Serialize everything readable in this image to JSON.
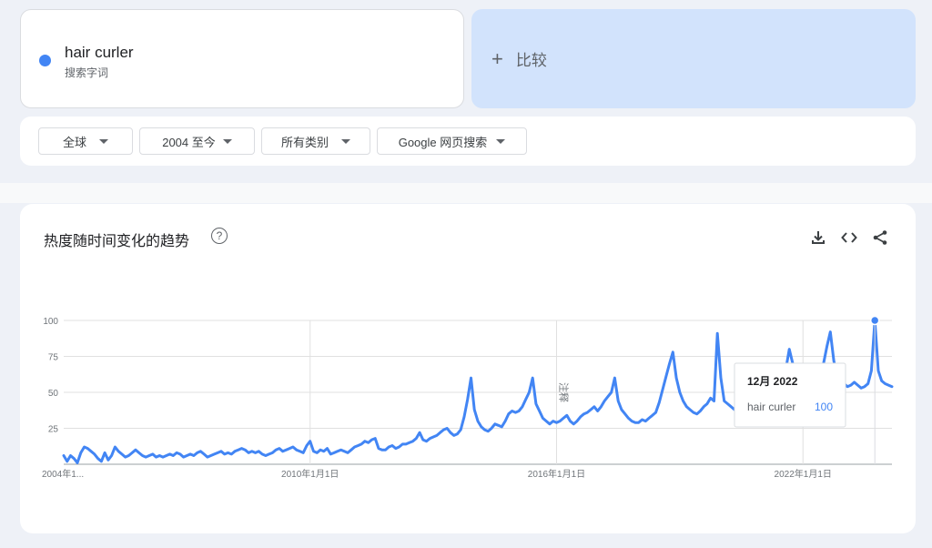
{
  "search_term": {
    "label": "hair curler",
    "type_label": "搜索字词",
    "color": "#4285f4"
  },
  "compare": {
    "plus": "+",
    "label": "比较"
  },
  "filters": [
    {
      "label": "全球"
    },
    {
      "label": "2004 至今"
    },
    {
      "label": "所有类别"
    },
    {
      "label": "Google 网页搜索"
    }
  ],
  "chart_panel": {
    "title": "热度随时间变化的趋势",
    "help": "?",
    "icons": [
      "download-icon",
      "embed-code-icon",
      "share-icon"
    ]
  },
  "chart_data": {
    "type": "line",
    "ylim": [
      0,
      100
    ],
    "y_ticks": [
      "100",
      "75",
      "50",
      "25"
    ],
    "x_tick_labels": [
      "2004年1...",
      "2010年1月1日",
      "2016年1月1日",
      "2022年1月1日"
    ],
    "note_label": "注释",
    "grid": true,
    "series": [
      {
        "name": "hair curler",
        "color": "#4285f4",
        "yearly_values": [
          [
            6,
            2,
            6,
            4,
            1,
            8,
            12,
            11,
            9,
            7,
            4,
            2
          ],
          [
            8,
            3,
            6,
            12,
            9,
            7,
            5,
            6,
            8,
            10,
            8,
            6
          ],
          [
            5,
            6,
            7,
            5,
            6,
            5,
            6,
            7,
            6,
            8,
            7,
            5
          ],
          [
            6,
            7,
            6,
            8,
            9,
            7,
            5,
            6,
            7,
            8,
            9,
            7
          ],
          [
            8,
            7,
            9,
            10,
            11,
            10,
            8,
            9,
            8,
            9,
            7,
            6
          ],
          [
            7,
            8,
            10,
            11,
            9,
            10,
            11,
            12,
            10,
            9,
            8,
            13
          ],
          [
            16,
            9,
            8,
            10,
            9,
            11,
            7,
            8,
            9,
            10,
            9,
            8
          ],
          [
            10,
            12,
            13,
            14,
            16,
            15,
            17,
            18,
            11,
            10,
            10,
            12
          ],
          [
            13,
            11,
            12,
            14,
            14,
            15,
            16,
            18,
            22,
            17,
            16,
            18
          ],
          [
            19,
            20,
            22,
            24,
            25,
            22,
            20,
            21,
            24,
            33,
            45,
            60
          ],
          [
            38,
            30,
            26,
            24,
            23,
            25,
            28,
            27,
            26,
            30,
            35,
            37
          ],
          [
            36,
            37,
            40,
            45,
            50,
            60,
            42,
            37,
            32,
            30,
            28,
            30
          ],
          [
            29,
            30,
            32,
            34,
            30,
            28,
            30,
            33,
            35,
            36,
            38,
            40
          ],
          [
            37,
            40,
            44,
            47,
            50,
            60,
            44,
            38,
            35,
            32,
            30,
            29
          ],
          [
            29,
            31,
            30,
            32,
            34,
            36,
            43,
            52,
            61,
            70,
            78,
            60
          ],
          [
            50,
            44,
            40,
            38,
            36,
            35,
            37,
            40,
            42,
            46,
            44,
            91
          ],
          [
            60,
            44,
            42,
            40,
            38,
            36,
            37,
            38,
            39,
            41,
            40,
            40
          ],
          [
            44,
            46,
            48,
            50,
            52,
            50,
            48,
            66,
            80,
            70,
            60,
            52
          ],
          [
            52,
            50,
            52,
            54,
            56,
            60,
            70,
            82,
            92,
            72,
            60,
            58
          ],
          [
            56,
            54,
            55,
            57,
            55,
            53,
            54,
            56,
            65,
            100,
            65,
            58
          ],
          [
            56,
            55,
            54
          ]
        ]
      }
    ],
    "tooltip": {
      "date": "12月 2022",
      "series_name": "hair curler",
      "value": "100"
    }
  }
}
